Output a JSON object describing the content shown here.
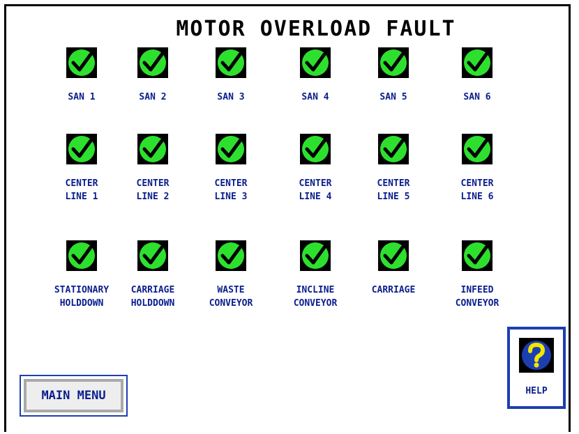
{
  "screen": {
    "title": "MOTOR OVERLOAD FAULT"
  },
  "colors": {
    "ok_green": "#2ee02e",
    "label_blue": "#0a1e8c",
    "button_border_blue": "#1c3fb0",
    "help_yellow": "#f2e600"
  },
  "rows": [
    {
      "items": [
        {
          "label": "SAN 1",
          "status": "ok",
          "icon": "check-icon"
        },
        {
          "label": "SAN 2",
          "status": "ok",
          "icon": "check-icon"
        },
        {
          "label": "SAN 3",
          "status": "ok",
          "icon": "check-icon"
        },
        {
          "label": "SAN 4",
          "status": "ok",
          "icon": "check-icon"
        },
        {
          "label": "SAN 5",
          "status": "ok",
          "icon": "check-icon"
        },
        {
          "label": "SAN 6",
          "status": "ok",
          "icon": "check-icon"
        }
      ]
    },
    {
      "items": [
        {
          "label": "CENTER\nLINE 1",
          "status": "ok",
          "icon": "check-icon"
        },
        {
          "label": "CENTER\nLINE 2",
          "status": "ok",
          "icon": "check-icon"
        },
        {
          "label": "CENTER\nLINE 3",
          "status": "ok",
          "icon": "check-icon"
        },
        {
          "label": "CENTER\nLINE 4",
          "status": "ok",
          "icon": "check-icon"
        },
        {
          "label": "CENTER\nLINE 5",
          "status": "ok",
          "icon": "check-icon"
        },
        {
          "label": "CENTER\nLINE 6",
          "status": "ok",
          "icon": "check-icon"
        }
      ]
    },
    {
      "items": [
        {
          "label": "STATIONARY\nHOLDDOWN",
          "status": "ok",
          "icon": "check-icon"
        },
        {
          "label": "CARRIAGE\nHOLDDOWN",
          "status": "ok",
          "icon": "check-icon"
        },
        {
          "label": "WASTE\nCONVEYOR",
          "status": "ok",
          "icon": "check-icon"
        },
        {
          "label": "INCLINE\nCONVEYOR",
          "status": "ok",
          "icon": "check-icon"
        },
        {
          "label": "CARRIAGE",
          "status": "ok",
          "icon": "check-icon"
        },
        {
          "label": "INFEED\nCONVEYOR",
          "status": "ok",
          "icon": "check-icon"
        }
      ]
    }
  ],
  "buttons": {
    "main_menu": "MAIN MENU",
    "help": "HELP",
    "help_icon": "question-mark-icon"
  }
}
